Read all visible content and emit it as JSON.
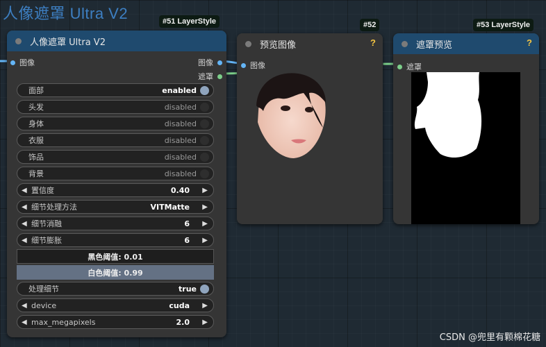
{
  "group_title": "人像遮罩 Ultra V2",
  "nodes": {
    "n51": {
      "badge": "#51 LayerStyle",
      "title": "人像遮罩 Ultra V2",
      "input": "图像",
      "outputs": [
        "图像",
        "遮罩"
      ],
      "toggles": [
        {
          "label": "面部",
          "value": "enabled",
          "on": true
        },
        {
          "label": "头发",
          "value": "disabled",
          "on": false
        },
        {
          "label": "身体",
          "value": "disabled",
          "on": false
        },
        {
          "label": "衣服",
          "value": "disabled",
          "on": false
        },
        {
          "label": "饰品",
          "value": "disabled",
          "on": false
        },
        {
          "label": "背景",
          "value": "disabled",
          "on": false
        }
      ],
      "combos": [
        {
          "label": "置信度",
          "value": "0.40"
        },
        {
          "label": "细节处理方法",
          "value": "VITMatte"
        },
        {
          "label": "细节消融",
          "value": "6"
        },
        {
          "label": "细节膨胀",
          "value": "6"
        }
      ],
      "black_threshold": "黑色阈值: 0.01",
      "white_threshold": "白色阈值: 0.99",
      "detail_toggle": {
        "label": "处理细节",
        "value": "true"
      },
      "combos2": [
        {
          "label": "device",
          "value": "cuda"
        },
        {
          "label": "max_megapixels",
          "value": "2.0"
        }
      ]
    },
    "n52": {
      "badge": "#52",
      "title": "预览图像",
      "input": "图像",
      "help": "?"
    },
    "n53": {
      "badge": "#53 LayerStyle",
      "title": "遮罩预览",
      "input": "遮罩",
      "help": "?"
    }
  },
  "colors": {
    "image_link": "#64b5f6",
    "mask_link": "#7ccf8a",
    "node_header": "#1f4a6e",
    "group_title": "#3d7fc2"
  },
  "watermark": "CSDN @兜里有颗棉花糖"
}
